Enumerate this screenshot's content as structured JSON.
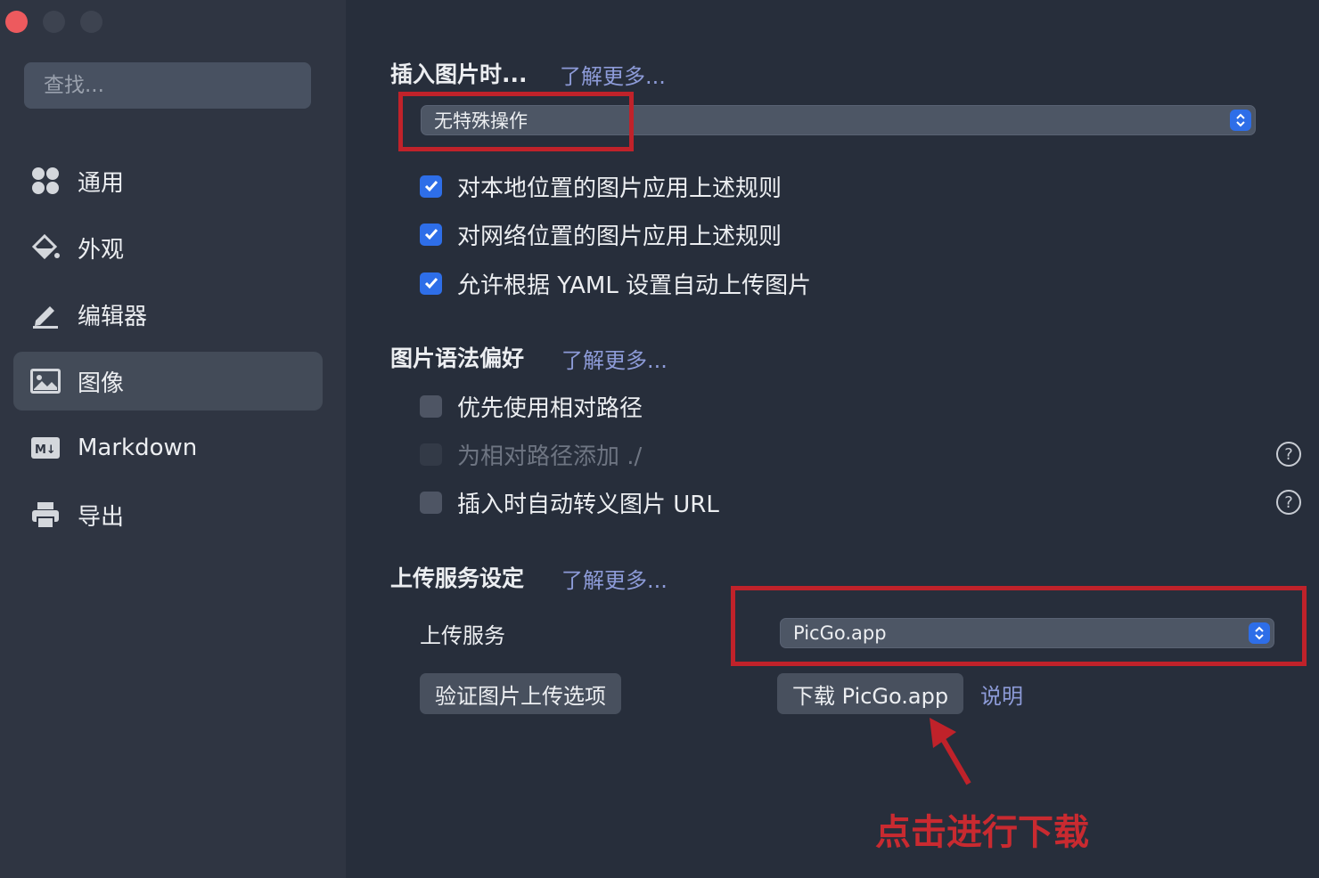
{
  "sidebar": {
    "search_placeholder": "查找...",
    "items": [
      {
        "label": "通用",
        "icon": "grid-icon"
      },
      {
        "label": "外观",
        "icon": "paint-bucket-icon"
      },
      {
        "label": "编辑器",
        "icon": "pencil-icon"
      },
      {
        "label": "图像",
        "icon": "image-icon",
        "active": true
      },
      {
        "label": "Markdown",
        "icon": "markdown-icon"
      },
      {
        "label": "导出",
        "icon": "printer-icon"
      }
    ]
  },
  "insert_image": {
    "title": "插入图片时...",
    "learn_more": "了解更多...",
    "select_value": "无特殊操作",
    "options": [
      {
        "label": "对本地位置的图片应用上述规则",
        "checked": true
      },
      {
        "label": "对网络位置的图片应用上述规则",
        "checked": true
      },
      {
        "label": "允许根据 YAML 设置自动上传图片",
        "checked": true
      }
    ]
  },
  "image_syntax": {
    "title": "图片语法偏好",
    "learn_more": "了解更多...",
    "options": [
      {
        "label": "优先使用相对路径",
        "checked": false
      },
      {
        "label": "为相对路径添加 ./",
        "checked": false,
        "disabled": true
      },
      {
        "label": "插入时自动转义图片 URL",
        "checked": false
      }
    ]
  },
  "upload": {
    "title": "上传服务设定",
    "learn_more": "了解更多...",
    "service_label": "上传服务",
    "service_value": "PicGo.app",
    "verify_button": "验证图片上传选项",
    "download_button": "下载 PicGo.app",
    "explain_link": "说明"
  },
  "annotation": {
    "text": "点击进行下载",
    "color": "#c0222a"
  },
  "colors": {
    "accent": "#2e6ee8",
    "link": "#8d9bd8",
    "close": "#ed5a5e"
  }
}
